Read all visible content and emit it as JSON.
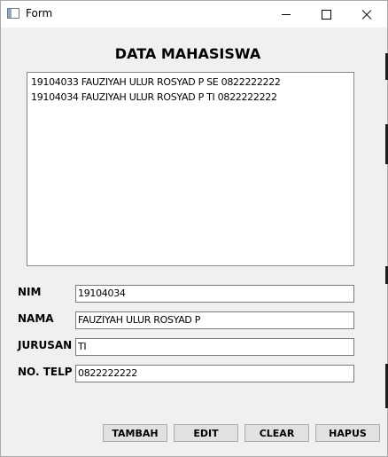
{
  "window": {
    "title": "Form",
    "icon": "form-icon"
  },
  "heading": "DATA MAHASISWA",
  "list": {
    "items": [
      "19104033 FAUZIYAH ULUR ROSYAD P SE 0822222222",
      "19104034 FAUZIYAH ULUR ROSYAD P TI 0822222222"
    ]
  },
  "form": {
    "nim_label": "NIM",
    "nim_value": "19104034",
    "nama_label": "NAMA",
    "nama_value": "FAUZIYAH ULUR ROSYAD P",
    "jurusan_label": "JURUSAN",
    "jurusan_value": "TI",
    "telp_label": "NO. TELP",
    "telp_value": "0822222222"
  },
  "buttons": {
    "tambah": "TAMBAH",
    "edit": "EDIT",
    "clear": "CLEAR",
    "hapus": "HAPUS"
  }
}
